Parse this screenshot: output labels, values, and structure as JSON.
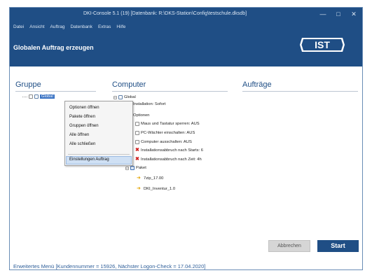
{
  "window": {
    "title": "DKI-Console 5.1 (19) [Datenbank: R:\\DKS-Station\\Config\\testschule.dksdb]",
    "minimize": "—",
    "maximize": "□",
    "close": "✕"
  },
  "menu": [
    "Datei",
    "Ansicht",
    "Auftrag",
    "Datenbank",
    "Extras",
    "Hilfe"
  ],
  "page_heading": "Globalen Auftrag erzeugen",
  "logo_text": "IST",
  "columns": {
    "group": "Gruppe",
    "computer": "Computer",
    "jobs": "Aufträge"
  },
  "group_tree": {
    "global": "Global"
  },
  "context_menu": [
    "Optionen öffnen",
    "Pakete öffnen",
    "Gruppen öffnen",
    "Alle öffnen",
    "Alle schließen",
    "Einstellungen Auftrag"
  ],
  "computer_tree": {
    "root": "Global",
    "installation": "Installation: Sofort",
    "options": "Optionen",
    "option_items": [
      "Maus und Tastatur sperren: AUS",
      "PC-Wächter einschalten: AUS",
      "Computer ausschalten: AUS",
      "Installationsabbruch nach Starts: 6",
      "Installationsabbruch nach Zeit: 4h"
    ],
    "package": "Paket",
    "package_items": [
      "7zip_17.00",
      "DKI_Inventur_1.0"
    ]
  },
  "buttons": {
    "cancel": "Abbrechen",
    "start": "Start"
  },
  "footer": "Erweitertes Menü [Kundennummer = 15926, Nächster Logon-Check = 17.04.2020]",
  "colors": {
    "header": "#1f4e85",
    "accent": "#3a73c4",
    "footer_text": "#2f5f9a"
  }
}
